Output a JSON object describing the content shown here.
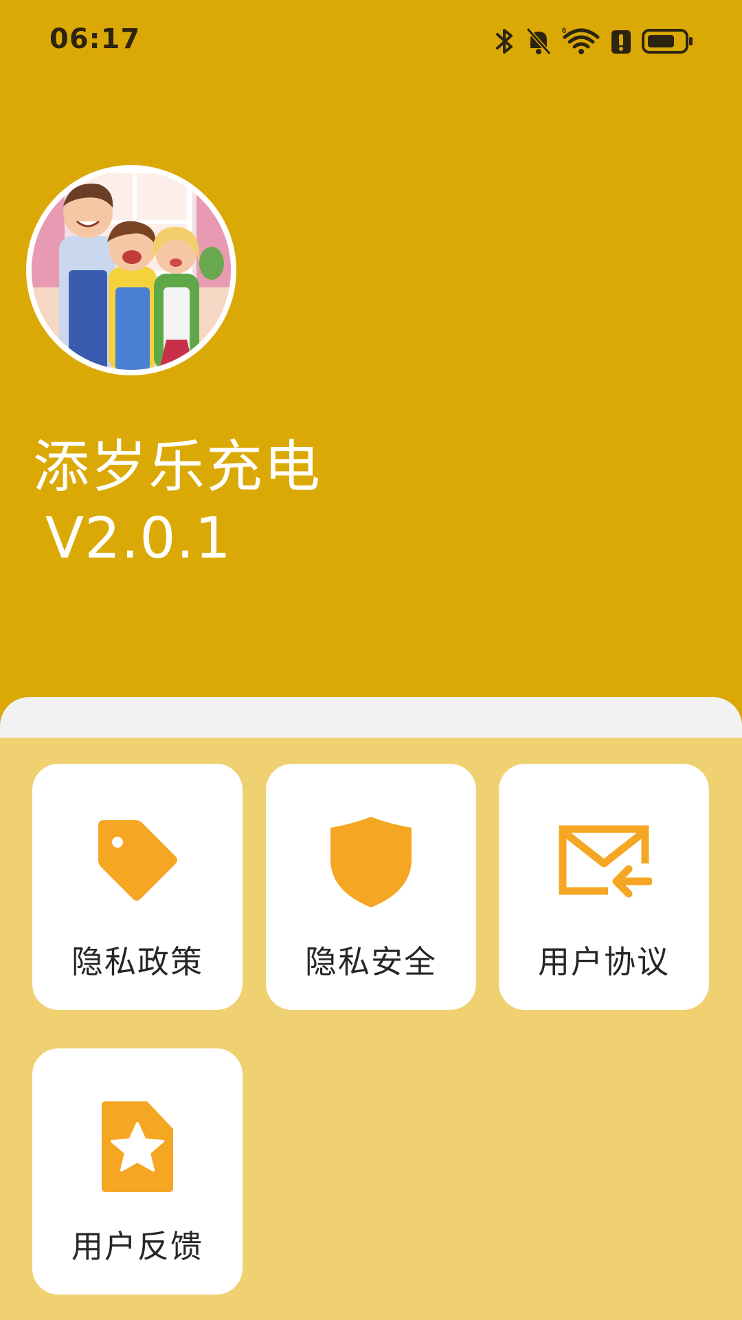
{
  "status_bar": {
    "time": "06:17",
    "icons": [
      "bluetooth-icon",
      "bell-off-icon",
      "wifi-icon",
      "alert-icon",
      "battery-icon"
    ]
  },
  "profile": {
    "avatar": "family-cartoon-avatar",
    "app_name": "添岁乐充电",
    "version": "V2.0.1"
  },
  "menu": {
    "items": [
      {
        "label": "隐私政策",
        "icon": "tag-icon"
      },
      {
        "label": "隐私安全",
        "icon": "shield-icon"
      },
      {
        "label": "用户协议",
        "icon": "mail-return-icon"
      },
      {
        "label": "用户反馈",
        "icon": "star-document-icon"
      }
    ]
  },
  "colors": {
    "header_background": "#dba906",
    "sheet_background": "#f0d172",
    "icon_accent": "#f5a623",
    "tile_background": "#ffffff"
  }
}
